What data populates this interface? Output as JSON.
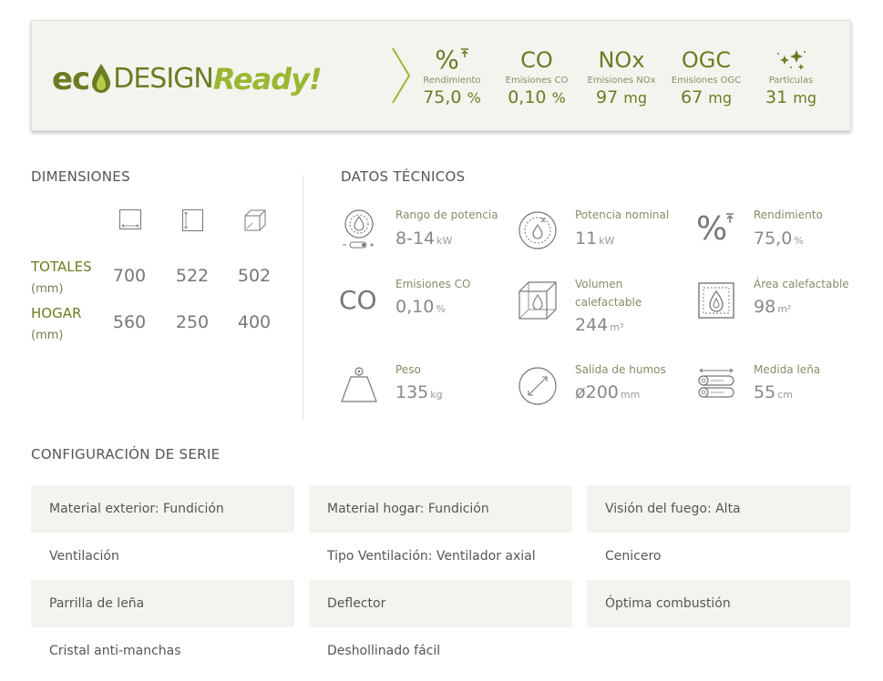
{
  "banner": {
    "logo": {
      "eco": "ec",
      "design": "DESIGN",
      "ready": "Ready!"
    },
    "metrics": [
      {
        "symbol": "%",
        "label": "Rendimiento",
        "value": "75,0",
        "unit": "%"
      },
      {
        "symbol": "CO",
        "label": "Emisiones CO",
        "value": "0,10",
        "unit": "%"
      },
      {
        "symbol": "NOx",
        "label": "Emisiones NOx",
        "value": "97",
        "unit": "mg"
      },
      {
        "symbol": "OGC",
        "label": "Emisiones OGC",
        "value": "67",
        "unit": "mg"
      },
      {
        "symbol": "",
        "label": "Partículas",
        "value": "31",
        "unit": "mg"
      }
    ],
    "colors": {
      "dark_green": "#6a7d22",
      "light_green": "#9bb732",
      "background": "#f4f4ef"
    }
  },
  "dimensions": {
    "title": "DIMENSIONES",
    "column_icons": [
      "width-icon",
      "height-icon",
      "depth-cube-icon"
    ],
    "rows": [
      {
        "label": "TOTALES",
        "unit": "(mm)",
        "values": [
          "700",
          "522",
          "502"
        ]
      },
      {
        "label": "HOGAR",
        "unit": "(mm)",
        "values": [
          "560",
          "250",
          "400"
        ]
      }
    ]
  },
  "tech": {
    "title": "DATOS TÉCNICOS",
    "items": [
      {
        "icon": "power-range-icon",
        "label": "Rango de potencia",
        "value": "8-14",
        "unit": "kW"
      },
      {
        "icon": "nominal-power-icon",
        "label": "Potencia nominal",
        "value": "11",
        "unit": "kW"
      },
      {
        "icon": "efficiency-icon",
        "icon_text": "%",
        "label": "Rendimiento",
        "value": "75,0",
        "unit": "%"
      },
      {
        "icon": "co-icon",
        "icon_text": "CO",
        "label": "Emisiones CO",
        "value": "0,10",
        "unit": "%"
      },
      {
        "icon": "volume-icon",
        "label": "Volumen",
        "label2": "calefactable",
        "value": "244",
        "unit": "m³"
      },
      {
        "icon": "heated-area-icon",
        "label": "Área calefactable",
        "value": "98",
        "unit": "m²"
      },
      {
        "icon": "weight-icon",
        "label": "Peso",
        "value": "135",
        "unit": "kg"
      },
      {
        "icon": "flue-outlet-icon",
        "label": "Salida de humos",
        "value": "ø200",
        "unit": "mm"
      },
      {
        "icon": "log-length-icon",
        "label": "Medida leña",
        "value": "55",
        "unit": "cm"
      }
    ]
  },
  "config": {
    "title": "CONFIGURACIÓN DE SERIE",
    "rows": [
      [
        "Material exterior: Fundición",
        "Material hogar: Fundición",
        "Visión del fuego: Alta"
      ],
      [
        "Ventilación",
        "Tipo Ventilación: Ventilador axial",
        "Cenicero"
      ],
      [
        "Parrilla de leña",
        "Deflector",
        "Óptima combustión"
      ],
      [
        "Cristal anti-manchas",
        "Deshollinado fácil",
        ""
      ]
    ]
  }
}
